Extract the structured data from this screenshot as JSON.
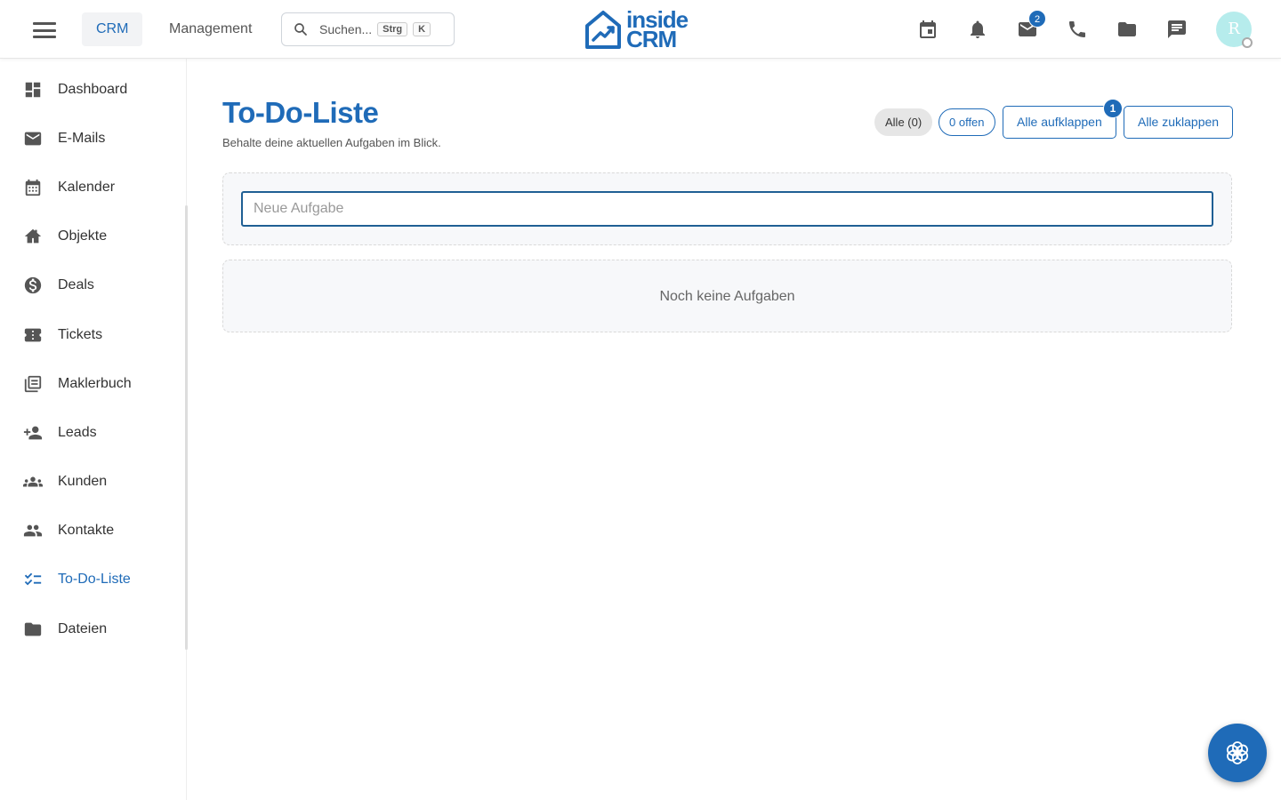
{
  "header": {
    "tabs": [
      {
        "label": "CRM",
        "active": true
      },
      {
        "label": "Management",
        "active": false
      }
    ],
    "search": {
      "placeholder": "Suchen...",
      "key1": "Strg",
      "key2": "K"
    },
    "logo": {
      "line1": "inside",
      "line2": "CRM"
    },
    "icons": [
      {
        "name": "calendar-icon"
      },
      {
        "name": "bell-icon"
      },
      {
        "name": "mail-icon",
        "badge": "2"
      },
      {
        "name": "phone-icon"
      },
      {
        "name": "folder-icon"
      },
      {
        "name": "chat-icon"
      }
    ],
    "avatar": {
      "initial": "R",
      "color": "#b6ecec"
    }
  },
  "sidebar": {
    "items": [
      {
        "label": "Dashboard",
        "icon": "dashboard-icon"
      },
      {
        "label": "E-Mails",
        "icon": "mail-icon"
      },
      {
        "label": "Kalender",
        "icon": "calendar-icon"
      },
      {
        "label": "Objekte",
        "icon": "home-icon"
      },
      {
        "label": "Deals",
        "icon": "dollar-icon"
      },
      {
        "label": "Tickets",
        "icon": "ticket-icon"
      },
      {
        "label": "Maklerbuch",
        "icon": "library-icon"
      },
      {
        "label": "Leads",
        "icon": "person-add-icon"
      },
      {
        "label": "Kunden",
        "icon": "groups-icon"
      },
      {
        "label": "Kontakte",
        "icon": "people-icon"
      },
      {
        "label": "To-Do-Liste",
        "icon": "checklist-icon",
        "active": true
      },
      {
        "label": "Dateien",
        "icon": "folder-icon"
      }
    ]
  },
  "main": {
    "title": "To-Do-Liste",
    "subtitle": "Behalte deine aktuellen Aufgaben im Blick.",
    "filters": {
      "all_label": "Alle (0)",
      "open_label": "0 offen"
    },
    "expand_label": "Alle aufklappen",
    "expand_badge": "1",
    "collapse_label": "Alle zuklappen",
    "new_task_placeholder": "Neue Aufgabe",
    "empty_text": "Noch keine Aufgaben"
  },
  "colors": {
    "accent": "#1f6bb8",
    "panel_bg": "#f7f8fa"
  }
}
